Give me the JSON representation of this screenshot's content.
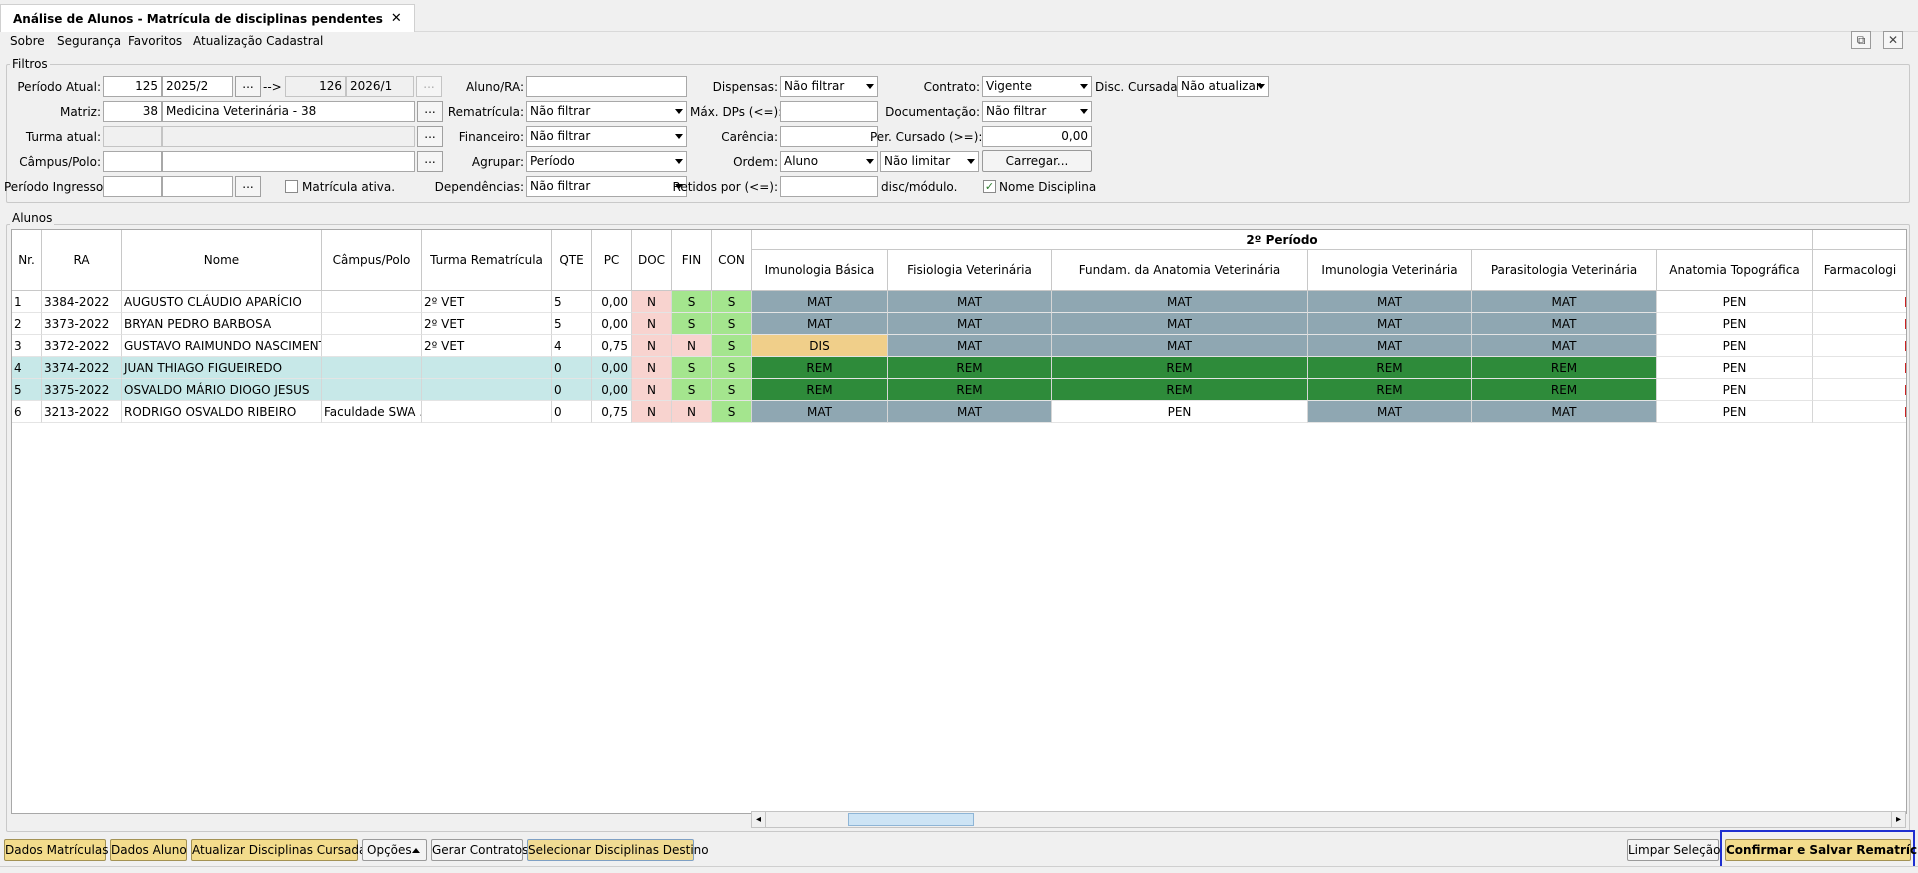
{
  "window": {
    "tab_title": "Análise de Alunos - Matrícula de disciplinas pendentes",
    "tab_close": "✕"
  },
  "menu": [
    "Sobre",
    "Segurança",
    "Favoritos",
    "Atualização Cadastral"
  ],
  "window_buttons": {
    "detach": "⧉",
    "close": "✕"
  },
  "filters": {
    "legend": "Filtros",
    "periodo_atual_label": "Período Atual:",
    "periodo_atual_code": "125",
    "periodo_atual_value": "2025/2",
    "arrow": "-->",
    "periodo_dest_code": "126",
    "periodo_dest_value": "2026/1",
    "matriz_label": "Matriz:",
    "matriz_code": "38",
    "matriz_value": "Medicina Veterinária - 38",
    "turma_label": "Turma atual:",
    "campus_label": "Câmpus/Polo:",
    "ingresso_label": "Período Ingresso:",
    "matricula_ativa_label": "Matrícula ativa.",
    "aluno_label": "Aluno/RA:",
    "rematricula_label": "Rematrícula:",
    "rematricula_value": "Não filtrar",
    "financeiro_label": "Financeiro:",
    "financeiro_value": "Não filtrar",
    "agrupar_label": "Agrupar:",
    "agrupar_value": "Período",
    "dependencias_label": "Dependências:",
    "dependencias_value": "Não filtrar",
    "dispensas_label": "Dispensas:",
    "dispensas_value": "Não filtrar",
    "max_dps_label": "Máx. DPs (<=):",
    "carencia_label": "Carência:",
    "ordem_label": "Ordem:",
    "ordem_value": "Aluno",
    "limite_value": "Não limitar",
    "retidos_label": "Retidos por (<=):",
    "disc_modulo_label": "disc/módulo.",
    "contrato_label": "Contrato:",
    "contrato_value": "Vigente",
    "documentacao_label": "Documentação:",
    "documentacao_value": "Não filtrar",
    "per_cursado_label": "Per. Cursado (>=):",
    "per_cursado_value": "0,00",
    "carregar_label": "Carregar...",
    "nome_disciplina_label": "Nome Disciplina",
    "disc_cursadas_label": "Disc. Cursadas:",
    "disc_cursadas_value": "Não atualizar",
    "ellipsis": "..."
  },
  "grid": {
    "legend": "Alunos",
    "group_header": "2º Período",
    "columns": [
      "Nr.",
      "RA",
      "Nome",
      "Câmpus/Polo",
      "Turma Rematrícula",
      "QTE",
      "PC",
      "DOC",
      "FIN",
      "CON"
    ],
    "disciplines": [
      "Imunologia Básica",
      "Fisiologia Veterinária",
      "Fundam. da Anatomia Veterinária",
      "Imunologia Veterinária",
      "Parasitologia Veterinária",
      "Anatomia Topográfica",
      "Farmacologi"
    ],
    "rows": [
      {
        "nr": "1",
        "ra": "3384-2022",
        "nome": "AUGUSTO CLÁUDIO APARÍCIO",
        "campus": "",
        "turma": "2º VET",
        "qte": "5",
        "pc": "0,00",
        "doc": "N",
        "fin": "S",
        "con": "S",
        "disc": [
          "MAT",
          "MAT",
          "MAT",
          "MAT",
          "MAT",
          "PEN",
          ""
        ]
      },
      {
        "nr": "2",
        "ra": "3373-2022",
        "nome": "BRYAN PEDRO BARBOSA",
        "campus": "",
        "turma": "2º VET",
        "qte": "5",
        "pc": "0,00",
        "doc": "N",
        "fin": "S",
        "con": "S",
        "disc": [
          "MAT",
          "MAT",
          "MAT",
          "MAT",
          "MAT",
          "PEN",
          ""
        ]
      },
      {
        "nr": "3",
        "ra": "3372-2022",
        "nome": "GUSTAVO RAIMUNDO NASCIMENTO",
        "campus": "",
        "turma": "2º VET",
        "qte": "4",
        "pc": "0,75",
        "doc": "N",
        "fin": "N",
        "con": "S",
        "disc": [
          "DIS",
          "MAT",
          "MAT",
          "MAT",
          "MAT",
          "PEN",
          ""
        ]
      },
      {
        "nr": "4",
        "ra": "3374-2022",
        "nome": "JUAN THIAGO FIGUEIREDO",
        "campus": "",
        "turma": "",
        "qte": "0",
        "pc": "0,00",
        "doc": "N",
        "fin": "S",
        "con": "S",
        "disc": [
          "REM",
          "REM",
          "REM",
          "REM",
          "REM",
          "PEN",
          ""
        ]
      },
      {
        "nr": "5",
        "ra": "3375-2022",
        "nome": "OSVALDO MÁRIO DIOGO JESUS",
        "campus": "",
        "turma": "",
        "qte": "0",
        "pc": "0,00",
        "doc": "N",
        "fin": "S",
        "con": "S",
        "disc": [
          "REM",
          "REM",
          "REM",
          "REM",
          "REM",
          "PEN",
          ""
        ]
      },
      {
        "nr": "6",
        "ra": "3213-2022",
        "nome": "RODRIGO OSVALDO RIBEIRO",
        "campus": "Faculdade SWA ...",
        "turma": "",
        "qte": "0",
        "pc": "0,75",
        "doc": "N",
        "fin": "N",
        "con": "S",
        "disc": [
          "MAT",
          "MAT",
          "PEN",
          "MAT",
          "MAT",
          "PEN",
          ""
        ]
      }
    ]
  },
  "status_colors": {
    "MAT": "#8fa7b2",
    "REM": "#2e8b3a",
    "DIS": "#f0cf8a",
    "PEN": "#ffffff",
    "doc_bg": "#f8d3cf",
    "yes_bg": "#a4e58e",
    "no_bg": "#f8d3cf",
    "selected_row": "#c7e8e8"
  },
  "bottom_buttons": {
    "dados_matriculas": "Dados Matrículas",
    "dados_aluno": "Dados Aluno",
    "atualizar": "Atualizar Disciplinas Cursadas",
    "opcoes": "Opções",
    "gerar_contratos": "Gerar Contratos",
    "selecionar": "Selecionar Disciplinas Destino",
    "limpar": "Limpar Seleção",
    "confirmar": "Confirmar e Salvar Rematrículas"
  }
}
